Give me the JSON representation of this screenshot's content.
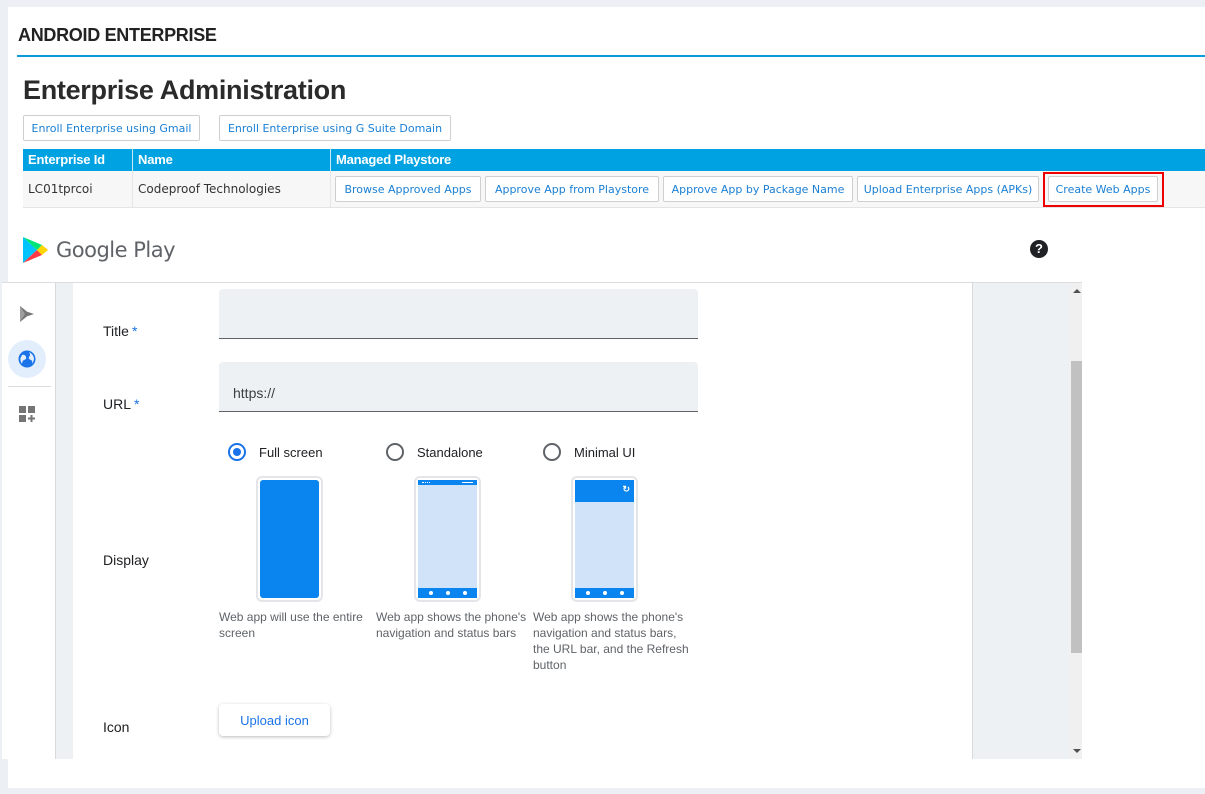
{
  "section": {
    "title": "ANDROID ENTERPRISE"
  },
  "page": {
    "title": "Enterprise Administration"
  },
  "enroll_buttons": {
    "gmail": "Enroll Enterprise using Gmail",
    "gsuite": "Enroll Enterprise using G Suite Domain"
  },
  "table": {
    "headers": [
      "Enterprise Id",
      "Name",
      "Managed Playstore"
    ],
    "row": {
      "enterprise_id": "LC01tprcoi",
      "name": "Codeproof Technologies",
      "actions": [
        "Browse Approved Apps",
        "Approve App from Playstore",
        "Approve App by Package Name",
        "Upload Enterprise Apps (APKs)",
        "Create Web Apps"
      ],
      "highlighted_action": "Create Web Apps"
    }
  },
  "google_play": {
    "brand": "Google Play",
    "help_icon": "help-circle-icon",
    "rail_icons": [
      "play-apps-icon",
      "web-globe-icon",
      "add-widgets-icon"
    ],
    "active_rail_item": "web-globe-icon"
  },
  "form": {
    "title": {
      "label": "Title",
      "required_mark": "*",
      "value": ""
    },
    "url": {
      "label": "URL",
      "required_mark": "*",
      "value": "https://"
    },
    "display": {
      "label": "Display",
      "selected": "Full screen",
      "options": [
        {
          "label": "Full screen",
          "description": "Web app will use the entire screen"
        },
        {
          "label": "Standalone",
          "description": "Web app shows the phone's navigation and status bars"
        },
        {
          "label": "Minimal UI",
          "description": "Web app shows the phone's navigation and status bars, the URL bar, and the Refresh button"
        }
      ]
    },
    "icon": {
      "label": "Icon",
      "button": "Upload icon"
    }
  },
  "colors": {
    "accent_header": "#00a2e2",
    "link_blue": "#1a7fd4",
    "google_blue": "#1a73e8",
    "phone_blue": "#0a84ee",
    "phone_light": "#d0e3f8",
    "highlight_red": "#e00000"
  }
}
